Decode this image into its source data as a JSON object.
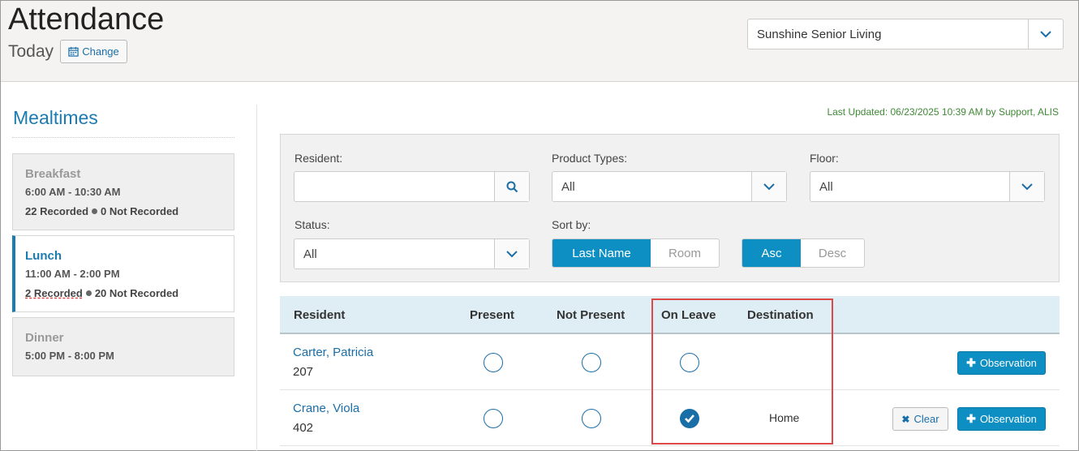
{
  "header": {
    "title": "Attendance",
    "date_label": "Today",
    "change_label": "Change",
    "facility": "Sunshine Senior Living"
  },
  "sidebar": {
    "title": "Mealtimes",
    "meals": [
      {
        "name": "Breakfast",
        "hours": "6:00 AM - 10:30 AM",
        "recorded": "22 Recorded",
        "not_recorded": "0 Not Recorded",
        "active": false
      },
      {
        "name": "Lunch",
        "hours": "11:00 AM - 2:00 PM",
        "recorded": "2 Recorded",
        "not_recorded": "20 Not Recorded",
        "active": true
      },
      {
        "name": "Dinner",
        "hours": "5:00 PM - 8:00 PM",
        "recorded": "",
        "not_recorded": "",
        "active": false
      }
    ]
  },
  "last_updated": "Last Updated: 06/23/2025 10:39 AM by Support, ALIS",
  "filters": {
    "resident_label": "Resident:",
    "resident_value": "",
    "product_types_label": "Product Types:",
    "product_types_value": "All",
    "floor_label": "Floor:",
    "floor_value": "All",
    "status_label": "Status:",
    "status_value": "All",
    "sort_label": "Sort by:",
    "sort_options": [
      "Last Name",
      "Room"
    ],
    "sort_selected": "Last Name",
    "order_options": [
      "Asc",
      "Desc"
    ],
    "order_selected": "Asc"
  },
  "table": {
    "columns": {
      "resident": "Resident",
      "present": "Present",
      "not_present": "Not Present",
      "on_leave": "On Leave",
      "destination": "Destination"
    },
    "rows": [
      {
        "name": "Carter, Patricia",
        "room": "207",
        "status": "none",
        "destination": "",
        "clear_label": "",
        "observation_label": "Observation"
      },
      {
        "name": "Crane, Viola",
        "room": "402",
        "status": "on_leave",
        "destination": "Home",
        "clear_label": "Clear",
        "observation_label": "Observation"
      }
    ]
  },
  "colors": {
    "accent": "#0d8fc4",
    "link": "#1a6ea8",
    "highlight": "#e04848",
    "updated": "#3f8a35"
  }
}
